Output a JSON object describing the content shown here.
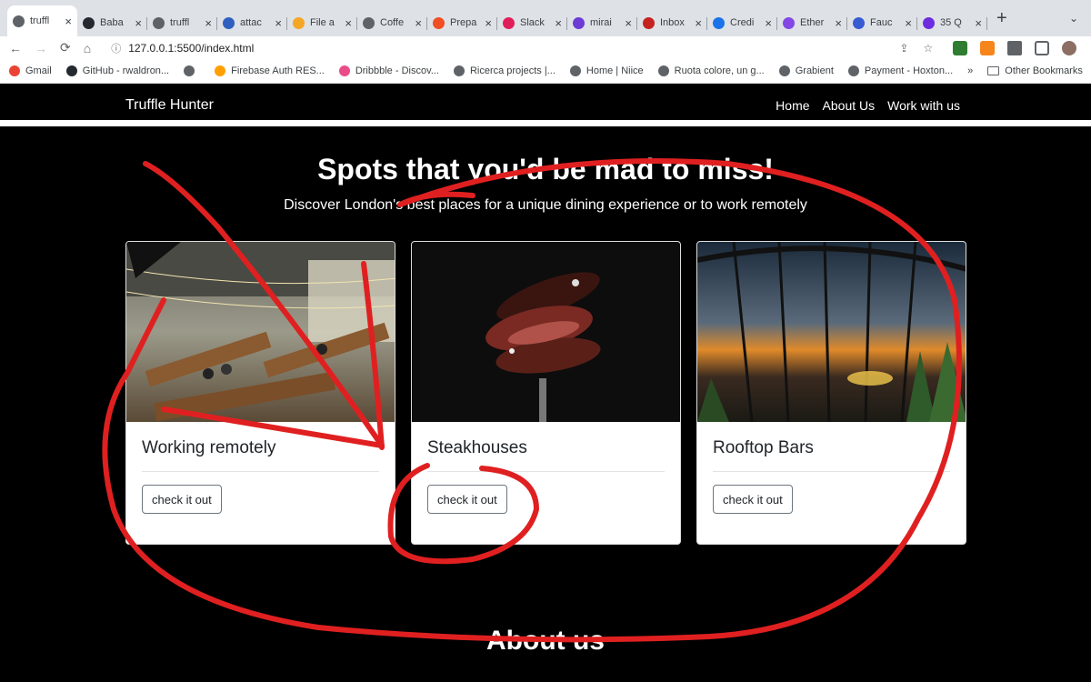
{
  "browser": {
    "tabs": [
      {
        "title": "truffl",
        "active": true,
        "color": "#5f6368"
      },
      {
        "title": "Baba",
        "color": "#24292f"
      },
      {
        "title": "truffl",
        "color": "#5f6368"
      },
      {
        "title": "attac",
        "color": "#2f5fbf"
      },
      {
        "title": "File a",
        "color": "#f5a623"
      },
      {
        "title": "Coffe",
        "color": "#5f6368"
      },
      {
        "title": "Prepa",
        "color": "#f04e23"
      },
      {
        "title": "Slack",
        "color": "#e01e5a"
      },
      {
        "title": "mirai",
        "color": "#6c3bd6"
      },
      {
        "title": "Inbox",
        "color": "#c5221f"
      },
      {
        "title": "Credi",
        "color": "#1a73e8"
      },
      {
        "title": "Ether",
        "color": "#8247e5"
      },
      {
        "title": "Fauc",
        "color": "#375bd2"
      },
      {
        "title": "35 Q",
        "color": "#6e2ce0"
      }
    ],
    "new_tab": "+",
    "tab_menu": "⌄",
    "url": "127.0.0.1:5500/index.html",
    "bookmarks": [
      {
        "label": "Gmail",
        "color": "#ea4335"
      },
      {
        "label": "GitHub - rwaldron...",
        "color": "#24292f"
      },
      {
        "label": "",
        "color": "#5f6368"
      },
      {
        "label": "Firebase Auth RES...",
        "color": "#ffa000"
      },
      {
        "label": "Dribbble - Discov...",
        "color": "#ea4c89"
      },
      {
        "label": "Ricerca projects |...",
        "color": "#5f6368"
      },
      {
        "label": "Home | Niice",
        "color": "#5f6368"
      },
      {
        "label": "Ruota colore, un g...",
        "color": "#5f6368"
      },
      {
        "label": "Grabient",
        "color": "#5f6368"
      },
      {
        "label": "Payment - Hoxton...",
        "color": "#5f6368"
      }
    ],
    "bookmarks_overflow": "»",
    "other_bookmarks": "Other Bookmarks"
  },
  "site": {
    "brand": "Truffle Hunter",
    "nav": [
      "Home",
      "About Us",
      "Work with us"
    ],
    "hero_title": "Spots that you'd be mad to miss!",
    "hero_subtitle": "Discover London's best places for a unique dining experience or to work remotely",
    "cards": [
      {
        "title": "Working remotely",
        "button": "check it out",
        "image": "coworking-space-photo"
      },
      {
        "title": "Steakhouses",
        "button": "check it out",
        "image": "steak-on-fork-photo"
      },
      {
        "title": "Rooftop Bars",
        "button": "check it out",
        "image": "rooftop-bar-sunset-photo"
      }
    ],
    "about_title": "About us"
  },
  "annotation_color": "#e02020"
}
